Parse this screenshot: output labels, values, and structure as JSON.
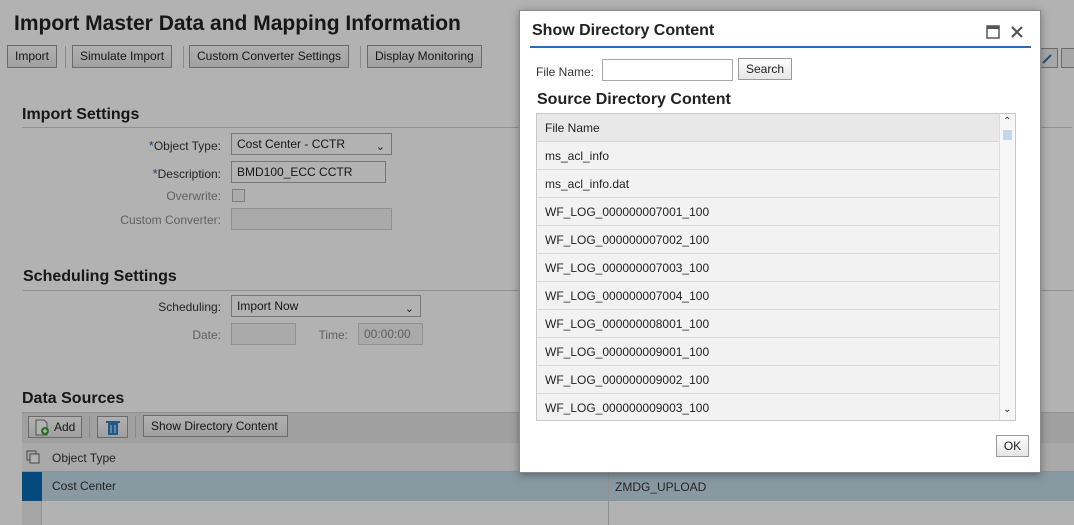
{
  "page": {
    "title": "Import Master Data and Mapping Information",
    "toolbar": [
      "Import",
      "Simulate Import",
      "Custom Converter Settings",
      "Display Monitoring"
    ]
  },
  "import_settings": {
    "title": "Import Settings",
    "object_type_label": "Object Type:",
    "object_type_value": "Cost Center - CCTR",
    "description_label": "Description:",
    "description_value": "BMD100_ECC CCTR",
    "overwrite_label": "Overwrite:",
    "custom_converter_label": "Custom Converter:",
    "required_marker": "*"
  },
  "scheduling_settings": {
    "title": "Scheduling Settings",
    "scheduling_label": "Scheduling:",
    "scheduling_value": "Import Now",
    "date_label": "Date:",
    "time_label": "Time:",
    "time_value": "00:00:00"
  },
  "data_sources": {
    "title": "Data Sources",
    "add_label": "Add",
    "show_dir_label": "Show Directory Content",
    "column_header": "Object Type",
    "row": {
      "object_type": "Cost Center",
      "source": "ZMDG_UPLOAD"
    }
  },
  "dialog": {
    "title": "Show Directory Content",
    "file_name_label": "File Name:",
    "search_label": "Search",
    "section_title": "Source Directory Content",
    "column_header": "File Name",
    "files": [
      "ms_acl_info",
      "ms_acl_info.dat",
      "WF_LOG_000000007001_100",
      "WF_LOG_000000007002_100",
      "WF_LOG_000000007003_100",
      "WF_LOG_000000007004_100",
      "WF_LOG_000000008001_100",
      "WF_LOG_000000009001_100",
      "WF_LOG_000000009002_100",
      "WF_LOG_000000009003_100"
    ],
    "ok_label": "OK"
  },
  "colors": {
    "accent": "#2a6ebb",
    "selection": "#c5dce8",
    "selection_marker": "#0a6ab3"
  },
  "icons": [
    "maximize-icon",
    "close-icon",
    "add-doc-icon",
    "trash-icon",
    "table-settings-icon",
    "chevron-down-icon"
  ]
}
